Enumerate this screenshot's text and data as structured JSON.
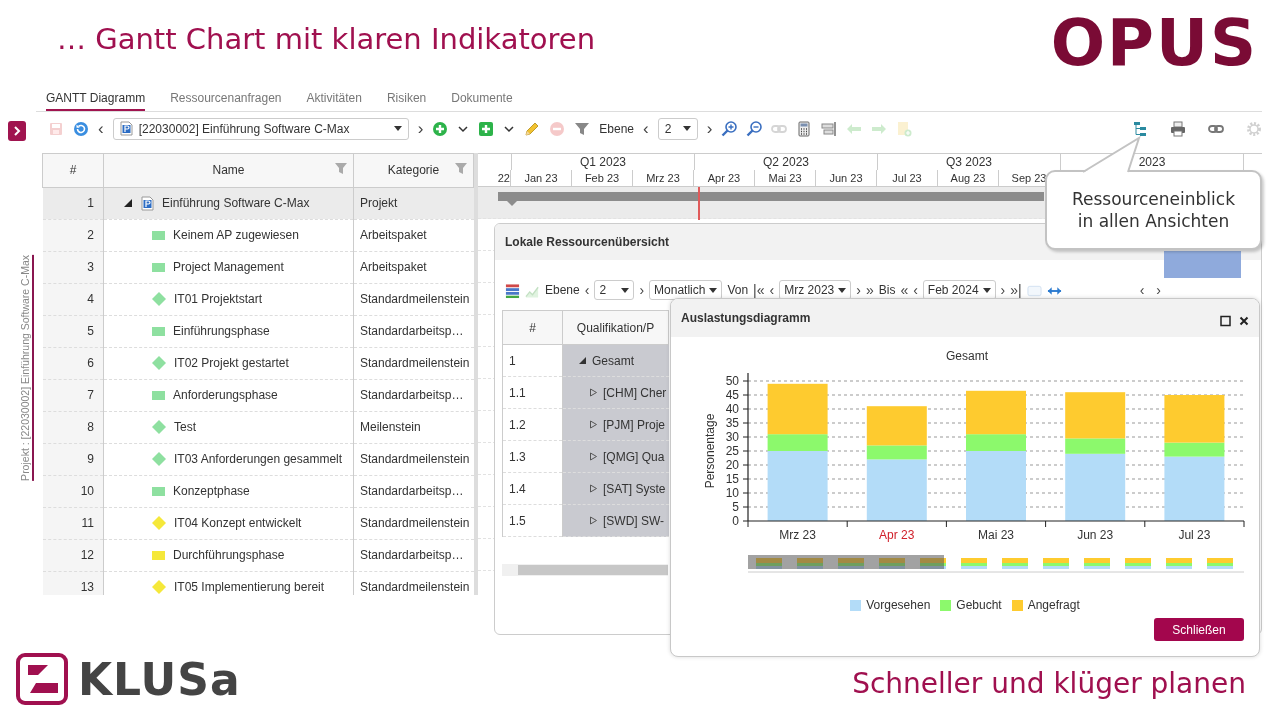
{
  "slide": {
    "title": "… Gantt Chart mit klaren Indikatoren",
    "logo": "OPUS",
    "footer_logo": "KLUSa",
    "tagline": "Schneller und klüger planen"
  },
  "sidebar": {
    "project_label": "Projekt : [22030002] Einführung Software C-Max"
  },
  "tabs": [
    {
      "label": "GANTT Diagramm",
      "selected": true
    },
    {
      "label": "Ressourcenanfragen",
      "selected": false
    },
    {
      "label": "Aktivitäten",
      "selected": false
    },
    {
      "label": "Risiken",
      "selected": false
    },
    {
      "label": "Dokumente",
      "selected": false
    }
  ],
  "toolbar": {
    "left": [
      {
        "kind": "save",
        "disabled": true
      },
      {
        "kind": "refresh",
        "disabled": false
      },
      {
        "kind": "nav",
        "text": "‹"
      },
      {
        "kind": "project-select",
        "value": "[22030002] Einführung Software C-Max"
      },
      {
        "kind": "nav",
        "text": "›"
      },
      {
        "kind": "add-circle",
        "disabled": false
      },
      {
        "kind": "caret"
      },
      {
        "kind": "add-square",
        "disabled": false
      },
      {
        "kind": "caret"
      },
      {
        "kind": "edit",
        "disabled": false
      },
      {
        "kind": "remove",
        "disabled": true
      },
      {
        "kind": "filter",
        "disabled": false
      },
      {
        "kind": "label",
        "text": "Ebene"
      },
      {
        "kind": "nav",
        "text": "‹"
      },
      {
        "kind": "select",
        "value": "2"
      },
      {
        "kind": "nav",
        "text": "›"
      },
      {
        "kind": "zoom-in",
        "disabled": false
      },
      {
        "kind": "zoom-out",
        "disabled": false
      },
      {
        "kind": "link",
        "disabled": true
      },
      {
        "kind": "calculator",
        "disabled": false
      },
      {
        "kind": "align",
        "disabled": false
      },
      {
        "kind": "arrow-left",
        "disabled": true
      },
      {
        "kind": "arrow-right",
        "disabled": true
      },
      {
        "kind": "sheet",
        "disabled": true
      }
    ],
    "right": [
      {
        "kind": "tree",
        "disabled": false
      },
      {
        "kind": "print",
        "disabled": false
      },
      {
        "kind": "link",
        "disabled": false
      },
      {
        "kind": "settings",
        "disabled": true
      }
    ]
  },
  "grid": {
    "columns": [
      {
        "label": "#",
        "filter": false
      },
      {
        "label": "Name",
        "filter": true
      },
      {
        "label": "Kategorie",
        "filter": true
      }
    ],
    "rows": [
      {
        "num": "1",
        "name": "Einführung Software C-Max",
        "category": "Projekt",
        "kind": "project",
        "selected": true,
        "expanded": true,
        "children": [
          {
            "num": "2",
            "name": "Keinem AP zugewiesen",
            "category": "Arbeitspaket",
            "kind": "task",
            "color": "#8ee0a0",
            "selected": false
          },
          {
            "num": "3",
            "name": "Project Management",
            "category": "Arbeitspaket",
            "kind": "task",
            "color": "#8ee0a0",
            "selected": false
          },
          {
            "num": "4",
            "name": "IT01 Projektstart",
            "category": "Standardmeilenstein",
            "kind": "milestone",
            "color": "#8ee0a0",
            "selected": false
          },
          {
            "num": "5",
            "name": "Einführungsphase",
            "category": "Standardarbeitsp…",
            "kind": "task",
            "color": "#8ee0a0",
            "selected": false
          },
          {
            "num": "6",
            "name": "IT02 Projekt gestartet",
            "category": "Standardmeilenstein",
            "kind": "milestone",
            "color": "#8ee0a0",
            "selected": false
          },
          {
            "num": "7",
            "name": "Anforderungsphase",
            "category": "Standardarbeitsp…",
            "kind": "task",
            "color": "#8ee0a0",
            "selected": false
          },
          {
            "num": "8",
            "name": "Test",
            "category": "Meilenstein",
            "kind": "milestone",
            "color": "#8ee0a0",
            "selected": false
          },
          {
            "num": "9",
            "name": "IT03 Anforderungen gesammelt",
            "category": "Standardmeilenstein",
            "kind": "milestone",
            "color": "#8ee0a0",
            "selected": false
          },
          {
            "num": "10",
            "name": "Konzeptphase",
            "category": "Standardarbeitsp…",
            "kind": "task",
            "color": "#8ee0a0",
            "selected": false
          },
          {
            "num": "11",
            "name": "IT04 Konzept entwickelt",
            "category": "Standardmeilenstein",
            "kind": "milestone",
            "color": "#f5e83a",
            "selected": false
          },
          {
            "num": "12",
            "name": "Durchführungsphase",
            "category": "Standardarbeitsp…",
            "kind": "task",
            "color": "#f5e83a",
            "selected": false
          },
          {
            "num": "13",
            "name": "IT05 Implementierung bereit",
            "category": "Standardmeilenstein",
            "kind": "milestone",
            "color": "#f5e83a",
            "selected": false
          }
        ]
      }
    ]
  },
  "timeline": {
    "quarters": [
      "Q1 2023",
      "Q2 2023",
      "Q3 2023",
      "2023"
    ],
    "months": [
      "22",
      "Jan 23",
      "Feb 23",
      "Mrz 23",
      "Apr 23",
      "Mai 23",
      "Jun 23",
      "Jul 23",
      "Aug 23",
      "Sep 23"
    ]
  },
  "resource_panel": {
    "title": "Lokale Ressourcenübersicht",
    "toolbar": [
      {
        "kind": "resource-list",
        "disabled": false
      },
      {
        "kind": "chart-line",
        "disabled": true
      },
      {
        "kind": "label",
        "text": "Ebene"
      },
      {
        "kind": "nav",
        "text": "‹"
      },
      {
        "kind": "select",
        "value": "2"
      },
      {
        "kind": "nav",
        "text": "›"
      },
      {
        "kind": "select",
        "value": "Monatlich"
      },
      {
        "kind": "label",
        "text": "Von"
      },
      {
        "kind": "nav",
        "text": "|«"
      },
      {
        "kind": "nav",
        "text": "‹"
      },
      {
        "kind": "select",
        "value": "Mrz 2023"
      },
      {
        "kind": "nav",
        "text": "›"
      },
      {
        "kind": "nav",
        "text": "»"
      },
      {
        "kind": "label",
        "text": "Bis"
      },
      {
        "kind": "nav",
        "text": "«"
      },
      {
        "kind": "nav",
        "text": "‹"
      },
      {
        "kind": "select",
        "value": "Feb 2024"
      },
      {
        "kind": "nav",
        "text": "›"
      },
      {
        "kind": "nav",
        "text": "»|"
      },
      {
        "kind": "frame",
        "disabled": true
      },
      {
        "kind": "expand-width",
        "disabled": false
      }
    ],
    "pager": [
      "‹",
      "›"
    ],
    "columns": [
      "#",
      "Qualifikation/P"
    ],
    "rows": [
      {
        "num": "1",
        "label": "Gesamt",
        "expanded": true,
        "children": [
          {
            "num": "1.1",
            "label": "[CHM] Cher",
            "expanded": false
          },
          {
            "num": "1.2",
            "label": "[PJM] Proje",
            "expanded": false
          },
          {
            "num": "1.3",
            "label": "[QMG] Qua",
            "expanded": false
          },
          {
            "num": "1.4",
            "label": "[SAT] Syste",
            "expanded": false
          },
          {
            "num": "1.5",
            "label": "[SWD] SW-",
            "expanded": false
          }
        ]
      }
    ]
  },
  "load_dialog": {
    "title": "Auslastungsdiagramm",
    "chart_data": {
      "type": "bar",
      "stacked": true,
      "title": "Gesamt",
      "ylabel": "Personentage",
      "categories": [
        "Mrz 23",
        "Apr 23",
        "Mai 23",
        "Jun 23",
        "Jul 23"
      ],
      "series": [
        {
          "name": "Vorgesehen",
          "color": "#b3dcf8",
          "values": [
            25,
            22,
            25,
            24,
            23
          ]
        },
        {
          "name": "Gebucht",
          "color": "#8cf96c",
          "values": [
            6,
            5,
            6,
            5.5,
            5
          ]
        },
        {
          "name": "Angefragt",
          "color": "#fecb2f",
          "values": [
            18,
            14,
            15.5,
            16.5,
            17
          ]
        }
      ],
      "ylim": [
        0,
        50
      ],
      "grid": true,
      "yticks": [
        0,
        5,
        10,
        15,
        20,
        25,
        30,
        35,
        40,
        45,
        50
      ]
    },
    "category_highlight": [
      false,
      true,
      false,
      false,
      false
    ],
    "button": "Schließen"
  },
  "callout": {
    "text": "Ressourceneinblick in allen Ansichten"
  }
}
